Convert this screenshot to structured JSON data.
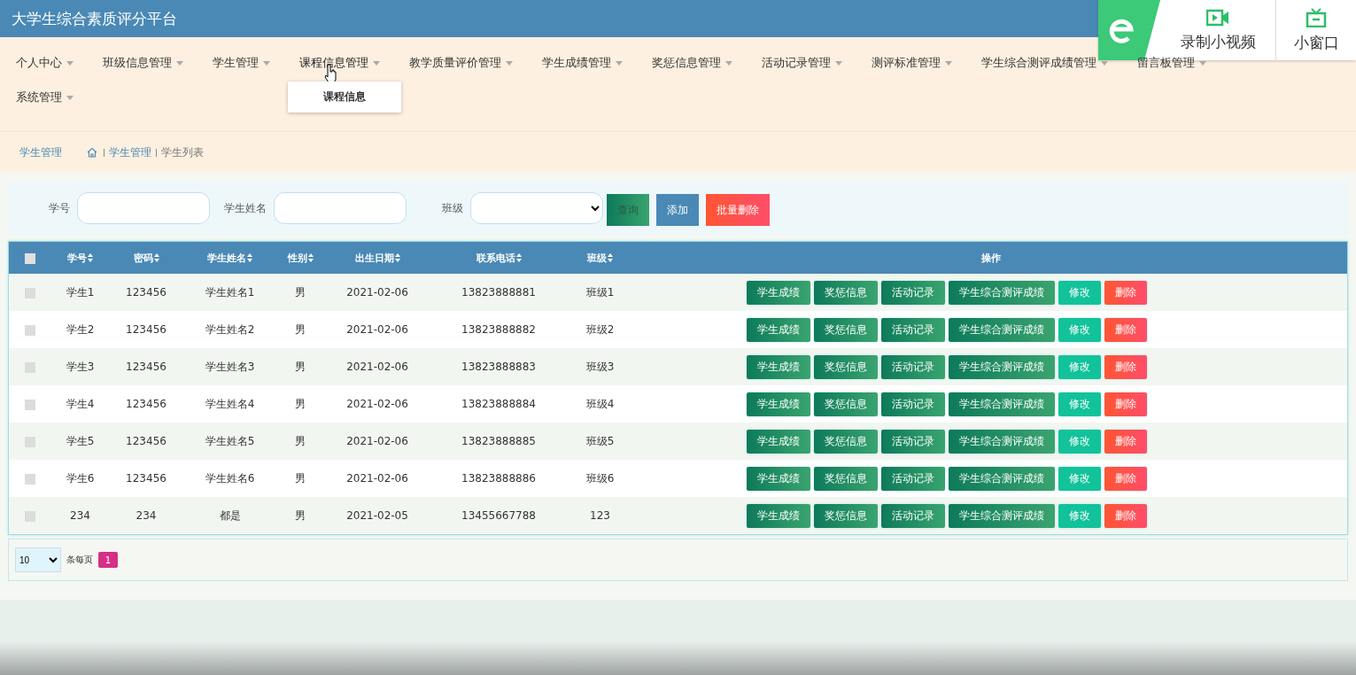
{
  "header": {
    "title": "大学生综合素质评分平台"
  },
  "recorder_overlay": {
    "record_label": "录制小视频",
    "mini_window_label": "小窗口"
  },
  "nav": {
    "items": [
      {
        "label": "个人中心",
        "expanded": false
      },
      {
        "label": "班级信息管理",
        "expanded": false
      },
      {
        "label": "学生管理",
        "expanded": false
      },
      {
        "label": "课程信息管理",
        "expanded": true,
        "children": [
          {
            "label": "课程信息"
          }
        ]
      },
      {
        "label": "教学质量评价管理",
        "expanded": false
      },
      {
        "label": "学生成绩管理",
        "expanded": false
      },
      {
        "label": "奖惩信息管理",
        "expanded": false
      },
      {
        "label": "活动记录管理",
        "expanded": false
      },
      {
        "label": "测评标准管理",
        "expanded": false
      },
      {
        "label": "学生综合测评成绩管理",
        "expanded": false
      },
      {
        "label": "留言板管理",
        "expanded": false
      },
      {
        "label": "系统管理",
        "expanded": false
      }
    ]
  },
  "breadcrumb": {
    "title": "学生管理",
    "path": [
      "学生管理",
      "学生列表"
    ]
  },
  "search": {
    "fields": [
      {
        "label": "学号",
        "kind": "text"
      },
      {
        "label": "学生姓名",
        "kind": "text"
      },
      {
        "label": "班级",
        "kind": "select"
      }
    ],
    "buttons": [
      {
        "label": "查询",
        "kind": "query"
      },
      {
        "label": "添加",
        "kind": "add"
      },
      {
        "label": "批量删除",
        "kind": "delete"
      }
    ]
  },
  "table": {
    "select_all_checked": false,
    "columns": [
      {
        "label": "学号",
        "sortable": true
      },
      {
        "label": "密码",
        "sortable": true
      },
      {
        "label": "学生姓名",
        "sortable": true
      },
      {
        "label": "性别",
        "sortable": true
      },
      {
        "label": "出生日期",
        "sortable": true
      },
      {
        "label": "联系电话",
        "sortable": true
      },
      {
        "label": "班级",
        "sortable": true
      },
      {
        "label": "操作",
        "sortable": false
      }
    ],
    "rows": [
      {
        "checked": false,
        "cells": [
          "学生1",
          "123456",
          "学生姓名1",
          "男",
          "2021-02-06",
          "13823888881",
          "班级1"
        ],
        "actions": [
          {
            "label": "学生成绩",
            "kind": "view"
          },
          {
            "label": "奖惩信息",
            "kind": "view"
          },
          {
            "label": "活动记录",
            "kind": "view"
          },
          {
            "label": "学生综合测评成绩",
            "kind": "view"
          },
          {
            "label": "修改",
            "kind": "edit"
          },
          {
            "label": "删除",
            "kind": "delete"
          }
        ]
      },
      {
        "checked": false,
        "cells": [
          "学生2",
          "123456",
          "学生姓名2",
          "男",
          "2021-02-06",
          "13823888882",
          "班级2"
        ],
        "actions": [
          {
            "label": "学生成绩",
            "kind": "view"
          },
          {
            "label": "奖惩信息",
            "kind": "view"
          },
          {
            "label": "活动记录",
            "kind": "view"
          },
          {
            "label": "学生综合测评成绩",
            "kind": "view"
          },
          {
            "label": "修改",
            "kind": "edit"
          },
          {
            "label": "删除",
            "kind": "delete"
          }
        ]
      },
      {
        "checked": false,
        "cells": [
          "学生3",
          "123456",
          "学生姓名3",
          "男",
          "2021-02-06",
          "13823888883",
          "班级3"
        ],
        "actions": [
          {
            "label": "学生成绩",
            "kind": "view"
          },
          {
            "label": "奖惩信息",
            "kind": "view"
          },
          {
            "label": "活动记录",
            "kind": "view"
          },
          {
            "label": "学生综合测评成绩",
            "kind": "view"
          },
          {
            "label": "修改",
            "kind": "edit"
          },
          {
            "label": "删除",
            "kind": "delete"
          }
        ]
      },
      {
        "checked": false,
        "cells": [
          "学生4",
          "123456",
          "学生姓名4",
          "男",
          "2021-02-06",
          "13823888884",
          "班级4"
        ],
        "actions": [
          {
            "label": "学生成绩",
            "kind": "view"
          },
          {
            "label": "奖惩信息",
            "kind": "view"
          },
          {
            "label": "活动记录",
            "kind": "view"
          },
          {
            "label": "学生综合测评成绩",
            "kind": "view"
          },
          {
            "label": "修改",
            "kind": "edit"
          },
          {
            "label": "删除",
            "kind": "delete"
          }
        ]
      },
      {
        "checked": false,
        "cells": [
          "学生5",
          "123456",
          "学生姓名5",
          "男",
          "2021-02-06",
          "13823888885",
          "班级5"
        ],
        "actions": [
          {
            "label": "学生成绩",
            "kind": "view"
          },
          {
            "label": "奖惩信息",
            "kind": "view"
          },
          {
            "label": "活动记录",
            "kind": "view"
          },
          {
            "label": "学生综合测评成绩",
            "kind": "view"
          },
          {
            "label": "修改",
            "kind": "edit"
          },
          {
            "label": "删除",
            "kind": "delete"
          }
        ]
      },
      {
        "checked": false,
        "cells": [
          "学生6",
          "123456",
          "学生姓名6",
          "男",
          "2021-02-06",
          "13823888886",
          "班级6"
        ],
        "actions": [
          {
            "label": "学生成绩",
            "kind": "view"
          },
          {
            "label": "奖惩信息",
            "kind": "view"
          },
          {
            "label": "活动记录",
            "kind": "view"
          },
          {
            "label": "学生综合测评成绩",
            "kind": "view"
          },
          {
            "label": "修改",
            "kind": "edit"
          },
          {
            "label": "删除",
            "kind": "delete"
          }
        ]
      },
      {
        "checked": false,
        "cells": [
          "234",
          "234",
          "都是",
          "男",
          "2021-02-05",
          "13455667788",
          "123"
        ],
        "actions": [
          {
            "label": "学生成绩",
            "kind": "view"
          },
          {
            "label": "奖惩信息",
            "kind": "view"
          },
          {
            "label": "活动记录",
            "kind": "view"
          },
          {
            "label": "学生综合测评成绩",
            "kind": "view"
          },
          {
            "label": "修改",
            "kind": "edit"
          },
          {
            "label": "删除",
            "kind": "delete"
          }
        ]
      }
    ]
  },
  "pagination": {
    "page_size": "10",
    "page_size_label": "条每页",
    "pages": [
      {
        "label": "1",
        "selected": true
      }
    ]
  }
}
